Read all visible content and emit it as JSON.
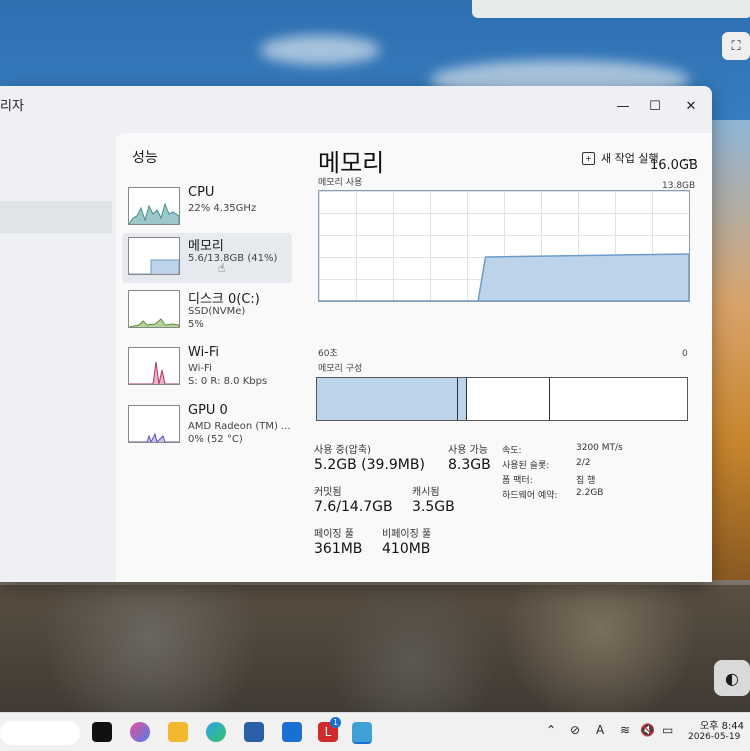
{
  "window": {
    "title_partial": "리자",
    "section_title": "성능",
    "run_new_task": "새 작업 실행",
    "more_label": "...",
    "buttons": {
      "minimize": "—",
      "maximize": "☐",
      "close": "✕"
    }
  },
  "resources": [
    {
      "name": "CPU",
      "sub1": "22% 4.35GHz",
      "sub2": ""
    },
    {
      "name": "메모리",
      "sub1": "5.6/13.8GB (41%)",
      "sub2": ""
    },
    {
      "name": "디스크 0(C:)",
      "sub1": "SSD(NVMe)",
      "sub2": "5%"
    },
    {
      "name": "Wi-Fi",
      "sub1": "Wi-Fi",
      "sub2": "S: 0 R: 8.0 Kbps"
    },
    {
      "name": "GPU 0",
      "sub1": "AMD Radeon (TM) ...",
      "sub2": "0% (52 °C)"
    }
  ],
  "memory": {
    "title": "메모리",
    "total": "16.0GB",
    "usage_label": "메모리 사용",
    "usage_max": "13.8GB",
    "time_start": "60초",
    "time_end": "0",
    "composition_label": "메모리 구성",
    "usage_fill": 0.4,
    "stats": {
      "in_use_label": "사용 중(압축)",
      "in_use_value": "5.2GB (39.9MB)",
      "available_label": "사용 가능",
      "available_value": "8.3GB",
      "committed_label": "커밋됨",
      "committed_value": "7.6/14.7GB",
      "cached_label": "캐시됨",
      "cached_value": "3.5GB",
      "paged_label": "페이징 풀",
      "paged_value": "361MB",
      "nonpaged_label": "비페이징 풀",
      "nonpaged_value": "410MB"
    },
    "specs": {
      "speed_k": "속도:",
      "speed_v": "3200 MT/s",
      "slots_k": "사용된 슬롯:",
      "slots_v": "2/2",
      "form_k": "폼 팩터:",
      "form_v": "칩 행",
      "reserved_k": "하드웨어 예약:",
      "reserved_v": "2.2GB"
    }
  },
  "taskbar": {
    "time": "오후 8:44",
    "date": "2026-05-19",
    "ime": "A",
    "badge": "1"
  },
  "colors": {
    "graph_fill": "#bcd3ea",
    "graph_line": "#6d9cc7"
  }
}
